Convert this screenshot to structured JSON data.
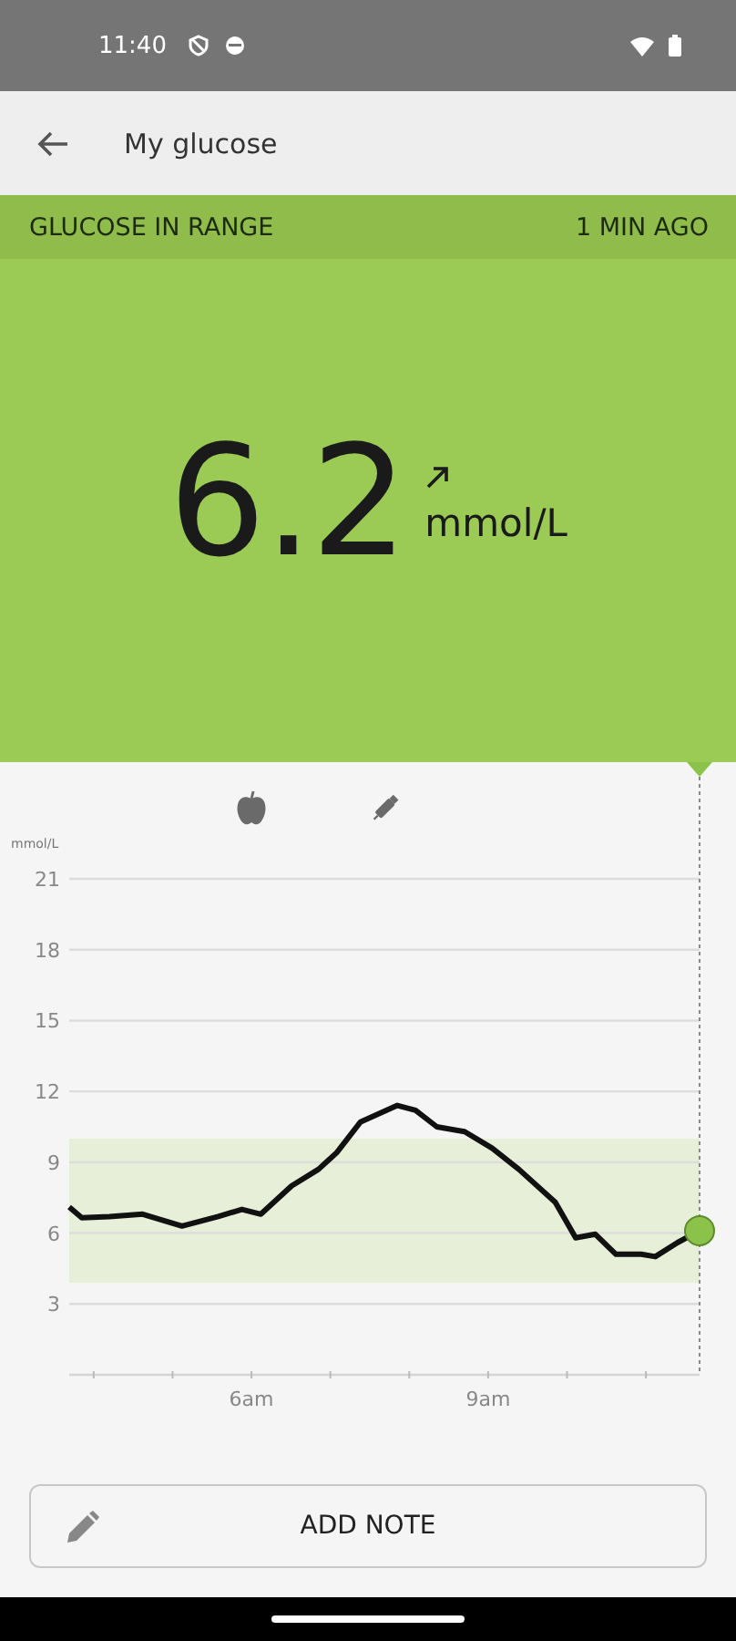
{
  "status_bar": {
    "time": "11:40"
  },
  "app_bar": {
    "title": "My glucose"
  },
  "status_strip": {
    "label": "GLUCOSE IN RANGE",
    "time": "1 MIN AGO"
  },
  "reading": {
    "value": "6.2",
    "unit": "mmol/L"
  },
  "event_markers": [
    {
      "kind": "food"
    },
    {
      "kind": "insulin"
    }
  ],
  "chart_data": {
    "type": "line",
    "ylabel": "mmol/L",
    "xlim": [
      3.69,
      11.68
    ],
    "ylim": [
      0,
      21
    ],
    "yticks": [
      3,
      6,
      9,
      12,
      15,
      18,
      21
    ],
    "xticks": [
      {
        "value": 6,
        "label": "6am"
      },
      {
        "value": 9,
        "label": "9am"
      }
    ],
    "x": [
      3.69,
      3.85,
      4.2,
      4.62,
      5.12,
      5.58,
      5.88,
      6.12,
      6.51,
      6.85,
      7.08,
      7.38,
      7.85,
      8.08,
      8.35,
      8.7,
      9.05,
      9.39,
      9.85,
      10.11,
      10.36,
      10.62,
      10.94,
      11.12,
      11.4,
      11.68
    ],
    "series": [
      {
        "color": "#111111",
        "values": [
          7.1,
          6.65,
          6.7,
          6.8,
          6.3,
          6.7,
          7.0,
          6.8,
          8.0,
          8.7,
          9.4,
          10.7,
          11.4,
          11.2,
          10.5,
          10.3,
          9.6,
          8.7,
          7.3,
          5.8,
          5.95,
          5.1,
          5.1,
          5.0,
          5.6,
          6.1
        ]
      }
    ],
    "grid": true,
    "bands": [
      {
        "axis": "y",
        "from": 3.9,
        "to": 10
      }
    ]
  },
  "add_note_button": {
    "label": "ADD NOTE"
  }
}
